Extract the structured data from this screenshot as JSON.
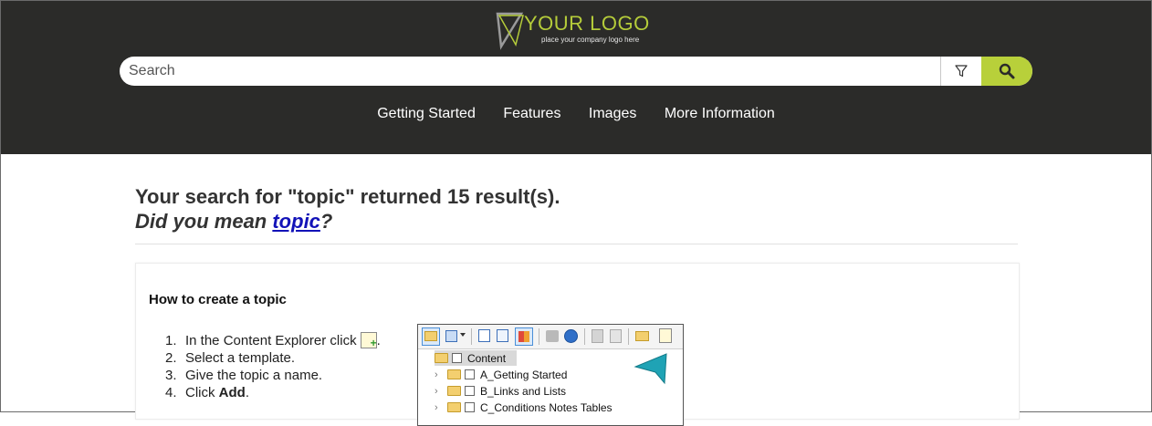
{
  "header": {
    "logo": {
      "title": "YOUR LOGO",
      "subtitle": "place your company logo here"
    },
    "search": {
      "placeholder": "Search",
      "value": ""
    },
    "nav": [
      "Getting Started",
      "Features",
      "Images",
      "More Information"
    ],
    "colors": {
      "background": "#2b2b29",
      "accent": "#b8d03a"
    }
  },
  "results": {
    "heading": "Your search for \"topic\" returned 15 result(s).",
    "did_you_mean_prefix": "Did you mean ",
    "did_you_mean_term": "topic",
    "did_you_mean_suffix": "?",
    "items": [
      {
        "title": "How to create a topic",
        "steps": [
          {
            "num": "1.",
            "text": "In the Content Explorer click",
            "icon": "new-topic-icon",
            "after": "."
          },
          {
            "num": "2.",
            "text": "Select a template."
          },
          {
            "num": "3.",
            "text": "Give the topic a name."
          },
          {
            "num": "4.",
            "text": "Click ",
            "bold": "Add",
            "after": "."
          }
        ],
        "explorer": {
          "root": "Content",
          "folders": [
            "A_Getting Started",
            "B_Links and Lists",
            "C_Conditions Notes Tables"
          ]
        }
      }
    ]
  }
}
